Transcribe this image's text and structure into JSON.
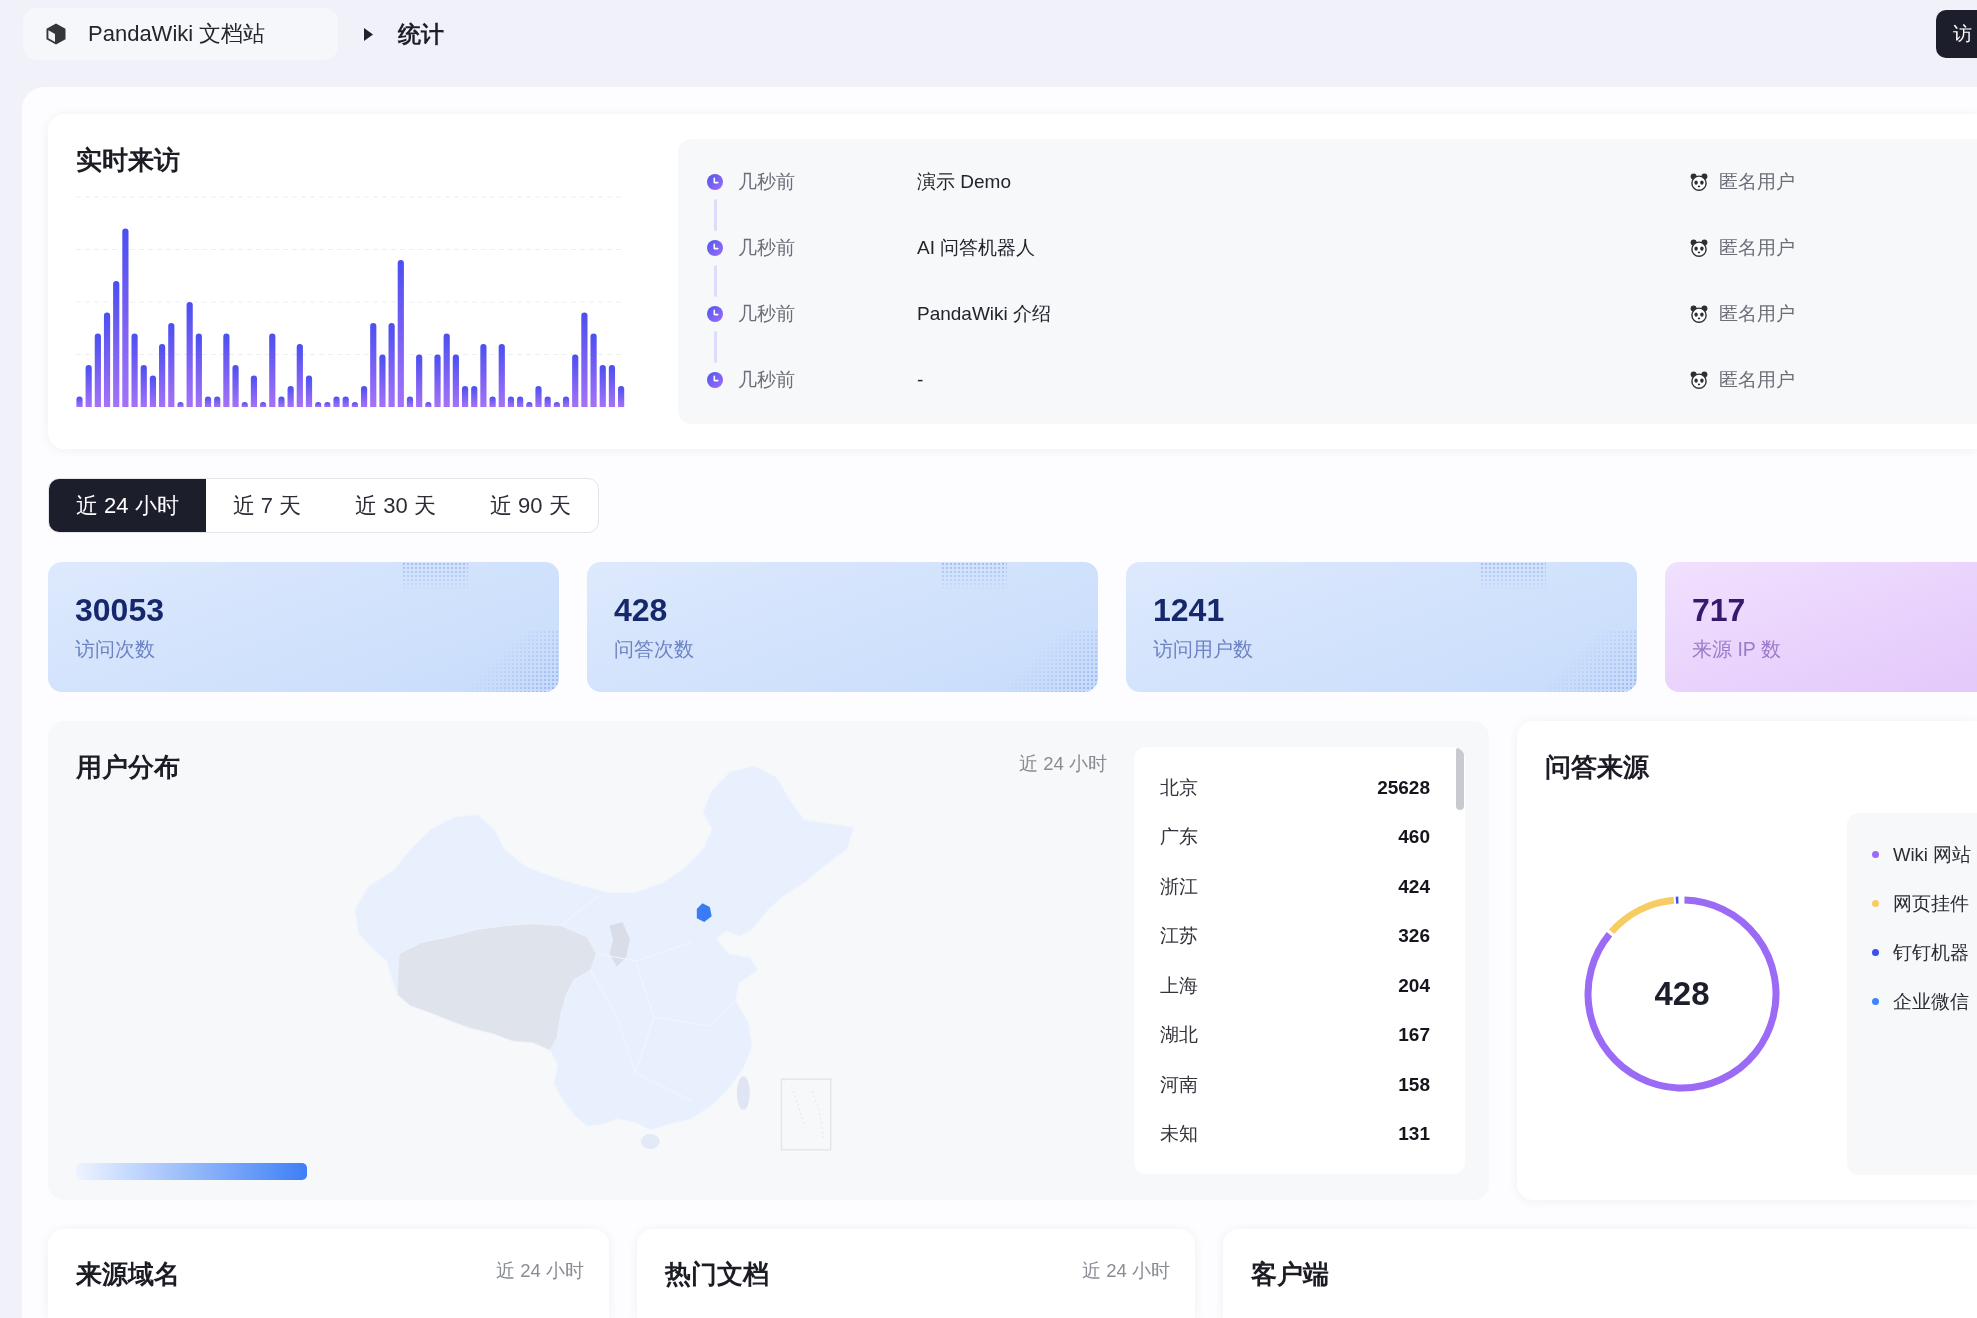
{
  "header": {
    "site_name": "PandaWiki 文档站",
    "page_title": "统计",
    "action_button": "访"
  },
  "realtime": {
    "title": "实时来访",
    "visits": [
      {
        "time": "几秒前",
        "page": "演示 Demo",
        "visitor": "匿名用户"
      },
      {
        "time": "几秒前",
        "page": "AI 问答机器人",
        "visitor": "匿名用户"
      },
      {
        "time": "几秒前",
        "page": "PandaWiki 介绍",
        "visitor": "匿名用户"
      },
      {
        "time": "几秒前",
        "page": "-",
        "visitor": "匿名用户"
      }
    ]
  },
  "period_tabs": [
    {
      "label": "近 24 小时",
      "selected": true
    },
    {
      "label": "近 7 天",
      "selected": false
    },
    {
      "label": "近 30 天",
      "selected": false
    },
    {
      "label": "近 90 天",
      "selected": false
    }
  ],
  "stats": [
    {
      "value": "30053",
      "label": "访问次数",
      "kind": "blue"
    },
    {
      "value": "428",
      "label": "问答次数",
      "kind": "blue"
    },
    {
      "value": "1241",
      "label": "访问用户数",
      "kind": "blue"
    },
    {
      "value": "717",
      "label": "来源 IP 数",
      "kind": "purple"
    }
  ],
  "user_distribution": {
    "title": "用户分布",
    "period": "近 24 小时",
    "regions": [
      {
        "name": "北京",
        "count": "25628"
      },
      {
        "name": "广东",
        "count": "460"
      },
      {
        "name": "浙江",
        "count": "424"
      },
      {
        "name": "江苏",
        "count": "326"
      },
      {
        "name": "上海",
        "count": "204"
      },
      {
        "name": "湖北",
        "count": "167"
      },
      {
        "name": "河南",
        "count": "158"
      },
      {
        "name": "未知",
        "count": "131"
      }
    ]
  },
  "qa_sources": {
    "title": "问答来源",
    "total": "428",
    "legend": [
      {
        "label": "Wiki 网站",
        "color": "#9c6bf6"
      },
      {
        "label": "网页挂件",
        "color": "#f7cd63"
      },
      {
        "label": "钉钉机器",
        "color": "#3c4ef0"
      },
      {
        "label": "企业微信",
        "color": "#3d86f6"
      }
    ]
  },
  "bottom_cards": [
    {
      "title": "来源域名",
      "period": "近 24 小时"
    },
    {
      "title": "热门文档",
      "period": "近 24 小时"
    },
    {
      "title": "客户端"
    }
  ]
}
